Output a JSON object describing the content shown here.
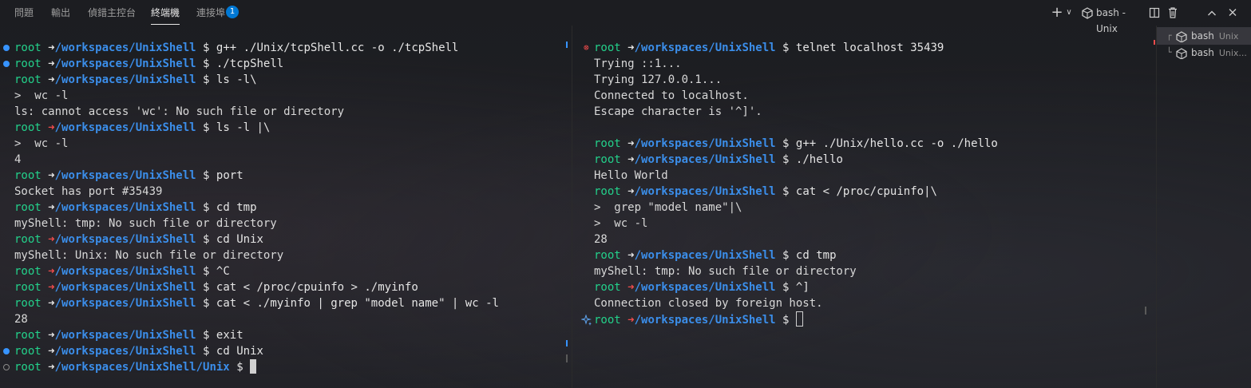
{
  "tabs": [
    {
      "label": "問題"
    },
    {
      "label": "輸出"
    },
    {
      "label": "偵錯主控台"
    },
    {
      "label": "終端機"
    },
    {
      "label": "連接埠"
    }
  ],
  "ports_badge": "1",
  "toolbar": {
    "add_symbol": "+",
    "dropdown_symbol": "∨",
    "terminal_label": "bash - Unix"
  },
  "prompt": {
    "user": "root",
    "arrow": "➜",
    "path": "/workspaces/UnixShell",
    "path_unix": "/workspaces/UnixShell/Unix",
    "dollar": "$"
  },
  "left_terminal": [
    {
      "kind": "prompt",
      "deco": "ok",
      "status": "ok",
      "cmd": "g++ ./Unix/tcpShell.cc -o ./tcpShell"
    },
    {
      "kind": "prompt",
      "deco": "ok",
      "status": "ok",
      "cmd": "./tcpShell"
    },
    {
      "kind": "prompt",
      "deco": "",
      "status": "ok",
      "cmd": "ls -l\\"
    },
    {
      "kind": "out",
      "text": ">  wc -l"
    },
    {
      "kind": "out",
      "text": "ls: cannot access 'wc': No such file or directory"
    },
    {
      "kind": "prompt",
      "deco": "",
      "status": "err",
      "cmd": "ls -l |\\"
    },
    {
      "kind": "out",
      "text": ">  wc -l"
    },
    {
      "kind": "out",
      "text": "4"
    },
    {
      "kind": "prompt",
      "deco": "",
      "status": "ok",
      "cmd": "port"
    },
    {
      "kind": "out",
      "text": "Socket has port #35439"
    },
    {
      "kind": "prompt",
      "deco": "",
      "status": "ok",
      "cmd": "cd tmp"
    },
    {
      "kind": "out",
      "text": "myShell: tmp: No such file or directory"
    },
    {
      "kind": "prompt",
      "deco": "",
      "status": "err",
      "cmd": "cd Unix"
    },
    {
      "kind": "out",
      "text": "myShell: Unix: No such file or directory"
    },
    {
      "kind": "prompt",
      "deco": "",
      "status": "err",
      "cmd": "^C"
    },
    {
      "kind": "prompt",
      "deco": "",
      "status": "err",
      "cmd": "cat < /proc/cpuinfo > ./myinfo"
    },
    {
      "kind": "prompt",
      "deco": "",
      "status": "ok",
      "cmd": "cat < ./myinfo | grep \"model name\" | wc -l"
    },
    {
      "kind": "out",
      "text": "28"
    },
    {
      "kind": "prompt",
      "deco": "",
      "status": "ok",
      "cmd": "exit"
    },
    {
      "kind": "prompt",
      "deco": "ok",
      "status": "ok",
      "cmd": "cd Unix"
    },
    {
      "kind": "prompt",
      "deco": "none",
      "status": "ok",
      "unix": true,
      "cmd": "",
      "cursor": "block"
    }
  ],
  "right_terminal": [
    {
      "kind": "prompt",
      "deco": "err",
      "status": "ok",
      "cmd": "telnet localhost 35439"
    },
    {
      "kind": "out",
      "text": "Trying ::1..."
    },
    {
      "kind": "out",
      "text": "Trying 127.0.0.1..."
    },
    {
      "kind": "out",
      "text": "Connected to localhost."
    },
    {
      "kind": "out",
      "text": "Escape character is '^]'."
    },
    {
      "kind": "out",
      "text": ""
    },
    {
      "kind": "prompt",
      "deco": "",
      "status": "ok",
      "cmd": "g++ ./Unix/hello.cc -o ./hello"
    },
    {
      "kind": "prompt",
      "deco": "",
      "status": "ok",
      "cmd": "./hello"
    },
    {
      "kind": "out",
      "text": "Hello World"
    },
    {
      "kind": "prompt",
      "deco": "",
      "status": "ok",
      "cmd": "cat < /proc/cpuinfo|\\"
    },
    {
      "kind": "out",
      "text": ">  grep \"model name\"|\\"
    },
    {
      "kind": "out",
      "text": ">  wc -l"
    },
    {
      "kind": "out",
      "text": "28"
    },
    {
      "kind": "prompt",
      "deco": "",
      "status": "ok",
      "cmd": "cd tmp"
    },
    {
      "kind": "out",
      "text": "myShell: tmp: No such file or directory"
    },
    {
      "kind": "prompt",
      "deco": "",
      "status": "err",
      "cmd": "^]"
    },
    {
      "kind": "out",
      "text": "Connection closed by foreign host."
    },
    {
      "kind": "prompt",
      "deco": "spark",
      "status": "err",
      "cmd": "",
      "cursor": "hollow"
    }
  ],
  "terminal_list": [
    {
      "tree": "┌",
      "name": "bash",
      "sub": "Unix",
      "selected": true
    },
    {
      "tree": "└",
      "name": "bash",
      "sub": "Unix...",
      "selected": false
    }
  ],
  "colors": {
    "background": "#1e1f22",
    "user": "#23d18b",
    "path": "#3b8eea",
    "error": "#f14c4c",
    "accent": "#0078d4"
  }
}
